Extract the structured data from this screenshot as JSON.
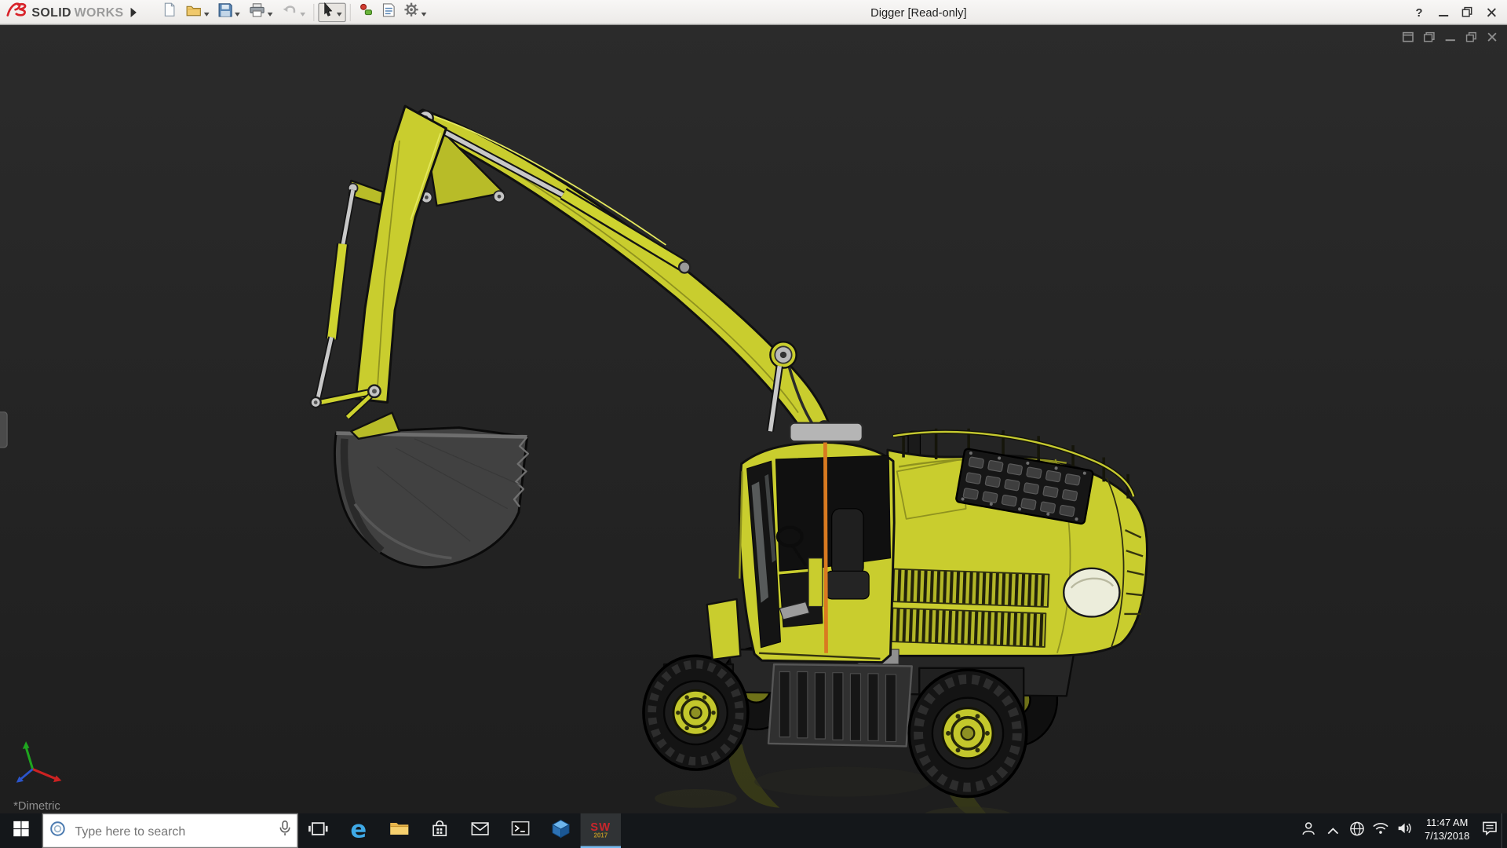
{
  "app": {
    "name_solid": "SOLID",
    "name_works": "WORKS"
  },
  "titlebar": {
    "title": "Digger [Read-only]",
    "help_label": "?",
    "toolbar_buttons": [
      {
        "name": "new-document",
        "has_dropdown": false,
        "enabled": true
      },
      {
        "name": "open",
        "has_dropdown": true,
        "enabled": true
      },
      {
        "name": "save",
        "has_dropdown": true,
        "enabled": true
      },
      {
        "name": "print",
        "has_dropdown": true,
        "enabled": true
      },
      {
        "name": "undo",
        "has_dropdown": true,
        "enabled": false
      },
      {
        "name": "select",
        "has_dropdown": true,
        "enabled": true,
        "active": true
      },
      {
        "name": "rebuild",
        "has_dropdown": false,
        "enabled": true
      },
      {
        "name": "file-properties",
        "has_dropdown": false,
        "enabled": true
      },
      {
        "name": "options",
        "has_dropdown": true,
        "enabled": true
      }
    ],
    "window_controls": [
      "help",
      "minimize",
      "restore",
      "close"
    ]
  },
  "viewport": {
    "view_label": "*Dimetric",
    "document_controls": [
      "new-window",
      "cascade",
      "minimize",
      "restore",
      "close"
    ]
  },
  "taskbar": {
    "search_placeholder": "Type here to search",
    "app_icons": [
      "start",
      "task-view",
      "edge",
      "file-explorer",
      "store",
      "mail",
      "terminal",
      "cad-cube",
      "solidworks-2017"
    ],
    "active_app": "solidworks-2017",
    "edge_glyph": "e",
    "sw_icon": {
      "top": "SW",
      "bottom": "2017"
    },
    "tray_icons": [
      "people",
      "hidden-icons",
      "network",
      "wifi",
      "volume",
      "action-center"
    ],
    "clock": {
      "time": "11:47 AM",
      "date": "7/13/2018"
    }
  },
  "colors": {
    "excavator_yellow": "#c9cd2e",
    "accent_orange": "#d97a20",
    "viewport_bg": "#262626",
    "titlebar_bg": "#f2f1ef",
    "taskbar_bg": "#14171a",
    "taskbar_accent": "#76b9ed",
    "logo_red": "#d8232a"
  }
}
